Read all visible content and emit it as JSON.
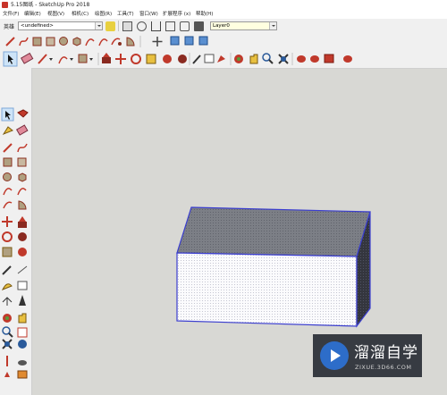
{
  "window": {
    "title": "5.15图纸 - SketchUp Pro 2018",
    "icon": "sketchup-logo-icon"
  },
  "menu": [
    "文件(F)",
    "编辑(E)",
    "视图(V)",
    "相机(C)",
    "绘图(R)",
    "工具(T)",
    "窗口(W)",
    "扩展程序 (x)",
    "帮助(H)"
  ],
  "toolbar1": {
    "style_label": "英雄",
    "material_value": "<undefined>",
    "layer_value": "Layer0"
  },
  "model": {
    "shape": "box",
    "edge_color": "#3b3ecf",
    "top_face_color": "#7c7f86",
    "front_face_color": "#fbfbfd",
    "side_face_color": "#34363e",
    "background_color": "#d8d8d4"
  },
  "watermark": {
    "brand": "溜溜自学",
    "url": "ZIXUE.3D66.COM",
    "icon": "play-circle-icon"
  }
}
